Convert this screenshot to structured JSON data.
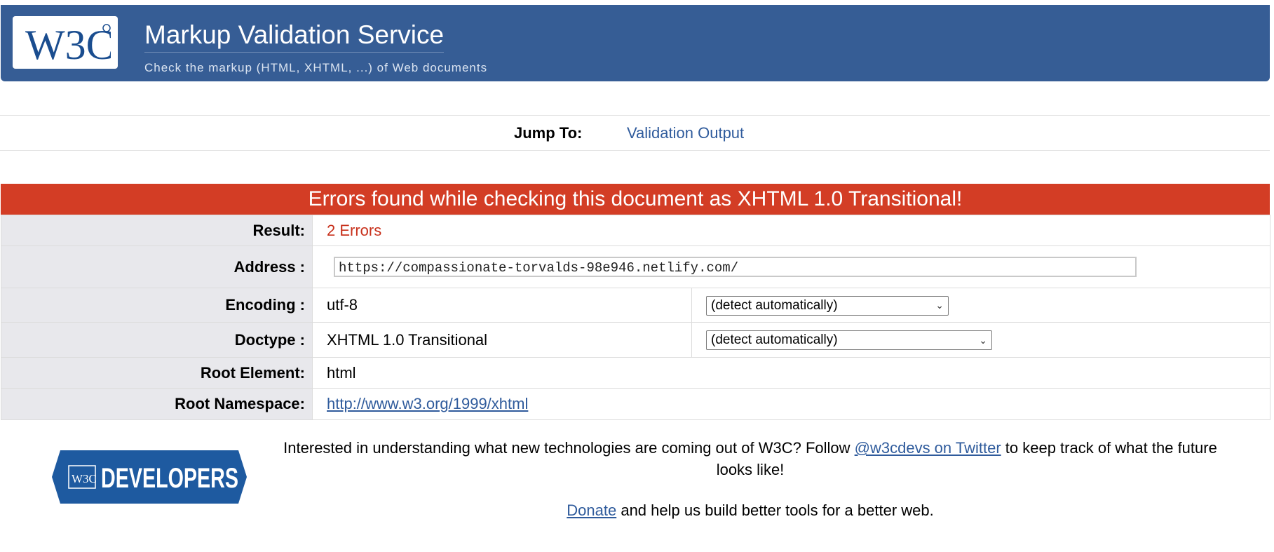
{
  "header": {
    "logo_text": "W3C",
    "title": "Markup Validation Service",
    "subtitle": "Check the markup (HTML, XHTML, ...) of Web documents"
  },
  "jump": {
    "label": "Jump To:",
    "link": "Validation Output"
  },
  "results": {
    "heading": "Errors found while checking this document as XHTML 1.0 Transitional!",
    "result_label": "Result:",
    "result_value": "2 Errors",
    "address_label": "Address :",
    "address_value": "https://compassionate-torvalds-98e946.netlify.com/",
    "encoding_label": "Encoding :",
    "encoding_value": "utf-8",
    "encoding_select": "(detect automatically)",
    "doctype_label": "Doctype :",
    "doctype_value": "XHTML 1.0 Transitional",
    "doctype_select": "(detect automatically)",
    "root_element_label": "Root Element:",
    "root_element_value": "html",
    "root_ns_label": "Root Namespace:",
    "root_ns_value": "http://www.w3.org/1999/xhtml"
  },
  "footer": {
    "badge_w3c": "W3C",
    "badge_text": "DEVELOPERS",
    "text_before": "Interested in understanding what new technologies are coming out of W3C? Follow ",
    "twitter_link": "@w3cdevs on Twitter",
    "text_after": " to keep track of what the future looks like!",
    "donate_link": "Donate",
    "donate_after": " and help us build better tools for a better web."
  },
  "colors": {
    "banner": "#365d95",
    "error_header": "#d33d25",
    "badge": "#1e5aa0"
  }
}
